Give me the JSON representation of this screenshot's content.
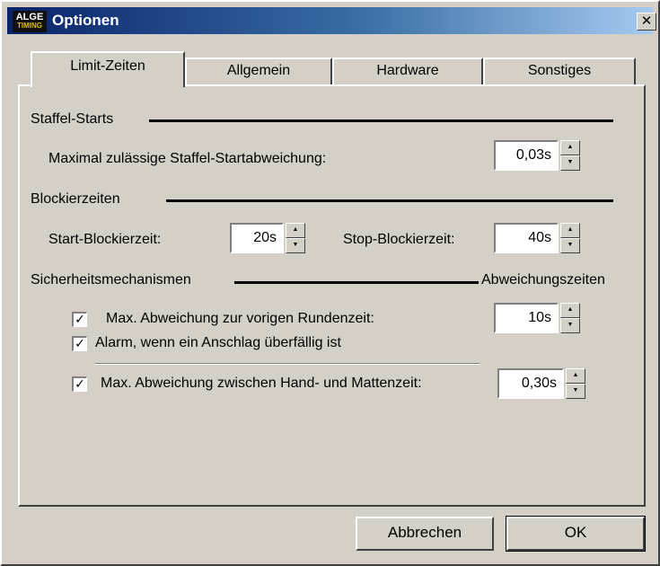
{
  "window": {
    "title": "Optionen",
    "logo_line1": "ALGE",
    "logo_line2": "TIMING",
    "close_glyph": "✕"
  },
  "tabs": [
    {
      "label": "Limit-Zeiten",
      "active": true
    },
    {
      "label": "Allgemein",
      "active": false
    },
    {
      "label": "Hardware",
      "active": false
    },
    {
      "label": "Sonstiges",
      "active": false
    }
  ],
  "staffel": {
    "header": "Staffel-Starts",
    "label": "Maximal zulässige Staffel-Startabweichung:",
    "value": "0,03s"
  },
  "blockier": {
    "header": "Blockierzeiten",
    "start_label": "Start-Blockierzeit:",
    "start_value": "20s",
    "stop_label": "Stop-Blockierzeit:",
    "stop_value": "40s"
  },
  "sicherheit": {
    "header": "Sicherheitsmechanismen",
    "right_header": "Abweichungszeiten",
    "items": [
      {
        "label": "Max. Abweichung zur vorigen Rundenzeit:",
        "checked": true,
        "value": "10s"
      },
      {
        "label": "Alarm, wenn ein Anschlag überfällig ist",
        "checked": true
      },
      {
        "label": "Max. Abweichung zwischen Hand- und Mattenzeit:",
        "checked": true,
        "value": "0,30s"
      }
    ]
  },
  "buttons": {
    "cancel": "Abbrechen",
    "ok": "OK"
  },
  "icons": {
    "spin_up": "▲",
    "spin_down": "▼",
    "check": "✓"
  },
  "colors": {
    "titlebar_start": "#0a246a",
    "titlebar_end": "#a6caf0",
    "dialog_bg": "#d4d0c8"
  }
}
